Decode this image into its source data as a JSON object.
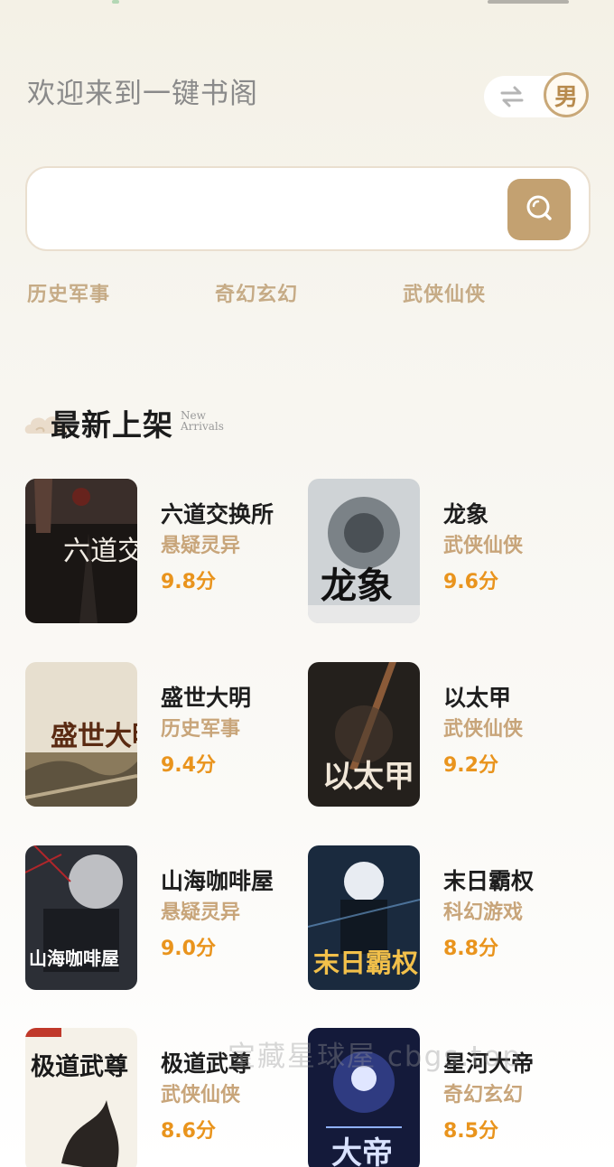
{
  "header": {
    "greeting": "欢迎来到一键书阁",
    "gender_label": "男"
  },
  "search": {
    "placeholder": ""
  },
  "categories": [
    "历史军事",
    "奇幻玄幻",
    "武侠仙侠"
  ],
  "section": {
    "title": "最新上架",
    "subtitle_line1": "New",
    "subtitle_line2": "Arrivals"
  },
  "books": [
    {
      "title": "六道交换所",
      "genre": "悬疑灵异",
      "score": "9.8分",
      "cover_text": "六道交换所"
    },
    {
      "title": "龙象",
      "genre": "武侠仙侠",
      "score": "9.6分",
      "cover_text": "龙象"
    },
    {
      "title": "盛世大明",
      "genre": "历史军事",
      "score": "9.4分",
      "cover_text": "盛世大明"
    },
    {
      "title": "以太甲",
      "genre": "武侠仙侠",
      "score": "9.2分",
      "cover_text": "以太甲"
    },
    {
      "title": "山海咖啡屋",
      "genre": "悬疑灵异",
      "score": "9.0分",
      "cover_text": "山海咖啡屋"
    },
    {
      "title": "末日霸权",
      "genre": "科幻游戏",
      "score": "8.8分",
      "cover_text": "末日霸权"
    },
    {
      "title": "极道武尊",
      "genre": "武侠仙侠",
      "score": "8.6分",
      "cover_text": "极道武尊"
    },
    {
      "title": "星河大帝",
      "genre": "奇幻玄幻",
      "score": "8.5分",
      "cover_text": "大帝"
    }
  ],
  "watermark": "宝藏星球屋 cbgs.top",
  "colors": {
    "accent": "#c3a171",
    "genre": "#c8a57a",
    "score": "#e9941d",
    "title": "#1e1e1e",
    "greeting": "#8a8a8a"
  }
}
